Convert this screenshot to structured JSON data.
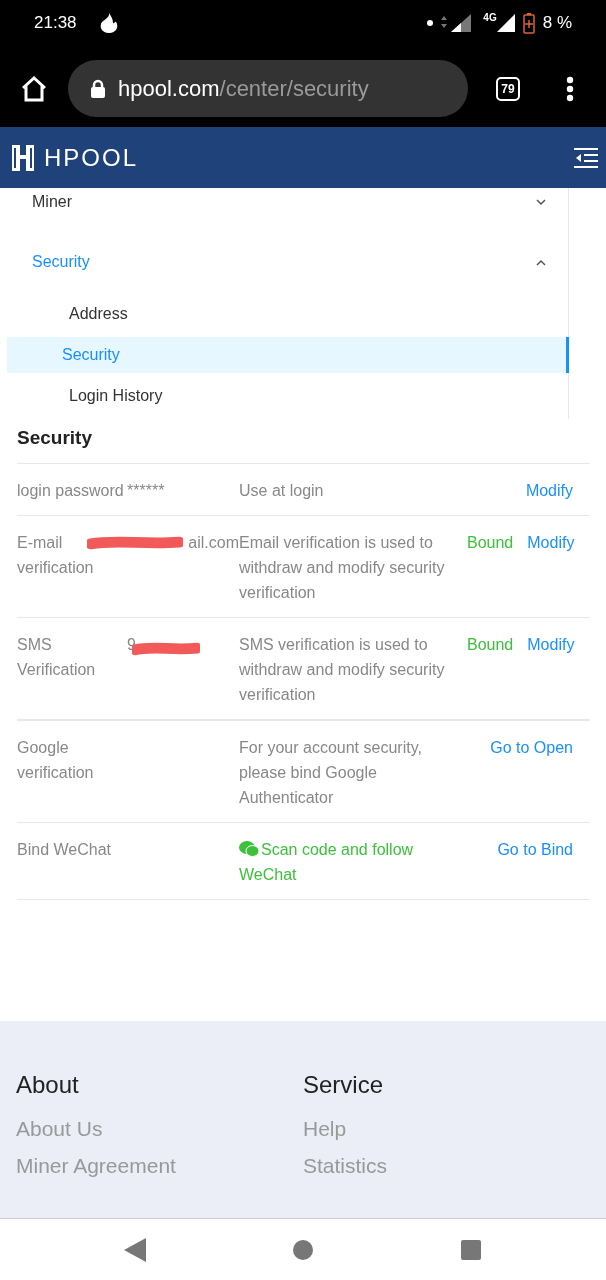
{
  "status_bar": {
    "time": "21:38",
    "network": "4G",
    "battery": "8 %"
  },
  "browser": {
    "host": "hpool.com",
    "path": "/center/security",
    "tab_count": "79"
  },
  "header": {
    "logo": "HPOOL"
  },
  "menu": [
    {
      "label": "Miner",
      "expanded": false,
      "selected": false
    },
    {
      "label": "Security",
      "expanded": true,
      "selected": true,
      "children": [
        {
          "label": "Address",
          "selected": false
        },
        {
          "label": "Security",
          "selected": true
        },
        {
          "label": "Login History",
          "selected": false
        }
      ]
    }
  ],
  "section_title": "Security",
  "rows": [
    {
      "label": "login password",
      "value": "******",
      "redacted": false,
      "description": "Use at login",
      "kind": "plain",
      "actions": [
        "Modify"
      ]
    },
    {
      "label": "E-mail verification",
      "value": "ail.com",
      "redacted": true,
      "description": "Email verification is used to withdraw and modify security verification",
      "kind": "plain",
      "status": "Bound",
      "actions": [
        "Modify"
      ]
    },
    {
      "label": "SMS Verification",
      "value": "9",
      "redacted": true,
      "description": "SMS verification is used to withdraw and modify security verification",
      "kind": "plain",
      "status": "Bound",
      "actions": [
        "Modify"
      ]
    },
    {
      "label": "Google verification",
      "redacted": false,
      "description": "For your account security, please bind Google Authenticator",
      "kind": "plain",
      "actions": [
        "Go to Open"
      ]
    },
    {
      "label": "Bind WeChat",
      "redacted": false,
      "description": "Scan code and follow WeChat",
      "kind": "wechat",
      "actions": [
        "Go to Bind"
      ]
    }
  ],
  "footer": [
    {
      "title": "About",
      "links": [
        "About Us",
        "Miner Agreement"
      ]
    },
    {
      "title": "Service",
      "links": [
        "Help",
        "Statistics"
      ]
    }
  ]
}
